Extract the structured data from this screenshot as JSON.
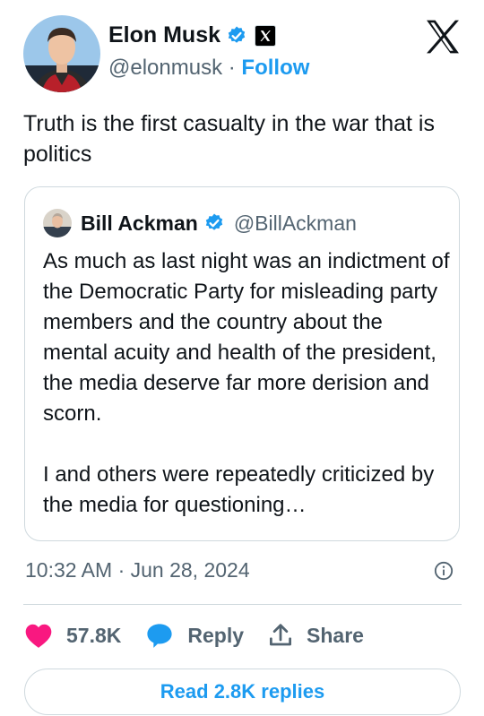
{
  "author": {
    "name": "Elon Musk",
    "handle": "@elonmusk",
    "separator": "·",
    "follow_label": "Follow"
  },
  "tweet": {
    "text": "Truth is the first casualty in the war that is politics"
  },
  "quoted_tweet": {
    "name": "Bill Ackman",
    "handle": "@BillAckman",
    "paragraphs": [
      "As much as last night was an indictment of the Democratic Party for misleading party members and the country about the mental acuity and health of the president, the media deserve far more derision and scorn.",
      "I and others were repeatedly criticized by the media for questioning…"
    ]
  },
  "meta": {
    "timestamp": "10:32 AM · Jun 28, 2024"
  },
  "actions": {
    "like_count": "57.8K",
    "reply_label": "Reply",
    "share_label": "Share"
  },
  "read_replies_label": "Read 2.8K replies",
  "icons": {
    "verified": "verified-badge-icon",
    "x_badge": "x-affiliate-badge-icon",
    "x_logo": "x-logo-icon",
    "info": "info-icon",
    "like": "heart-icon",
    "reply": "speech-bubble-icon",
    "share": "share-icon"
  },
  "colors": {
    "accent": "#1d9bf0",
    "like": "#f91880",
    "text": "#0f1419",
    "secondary": "#536471",
    "border": "#cfd9de"
  }
}
